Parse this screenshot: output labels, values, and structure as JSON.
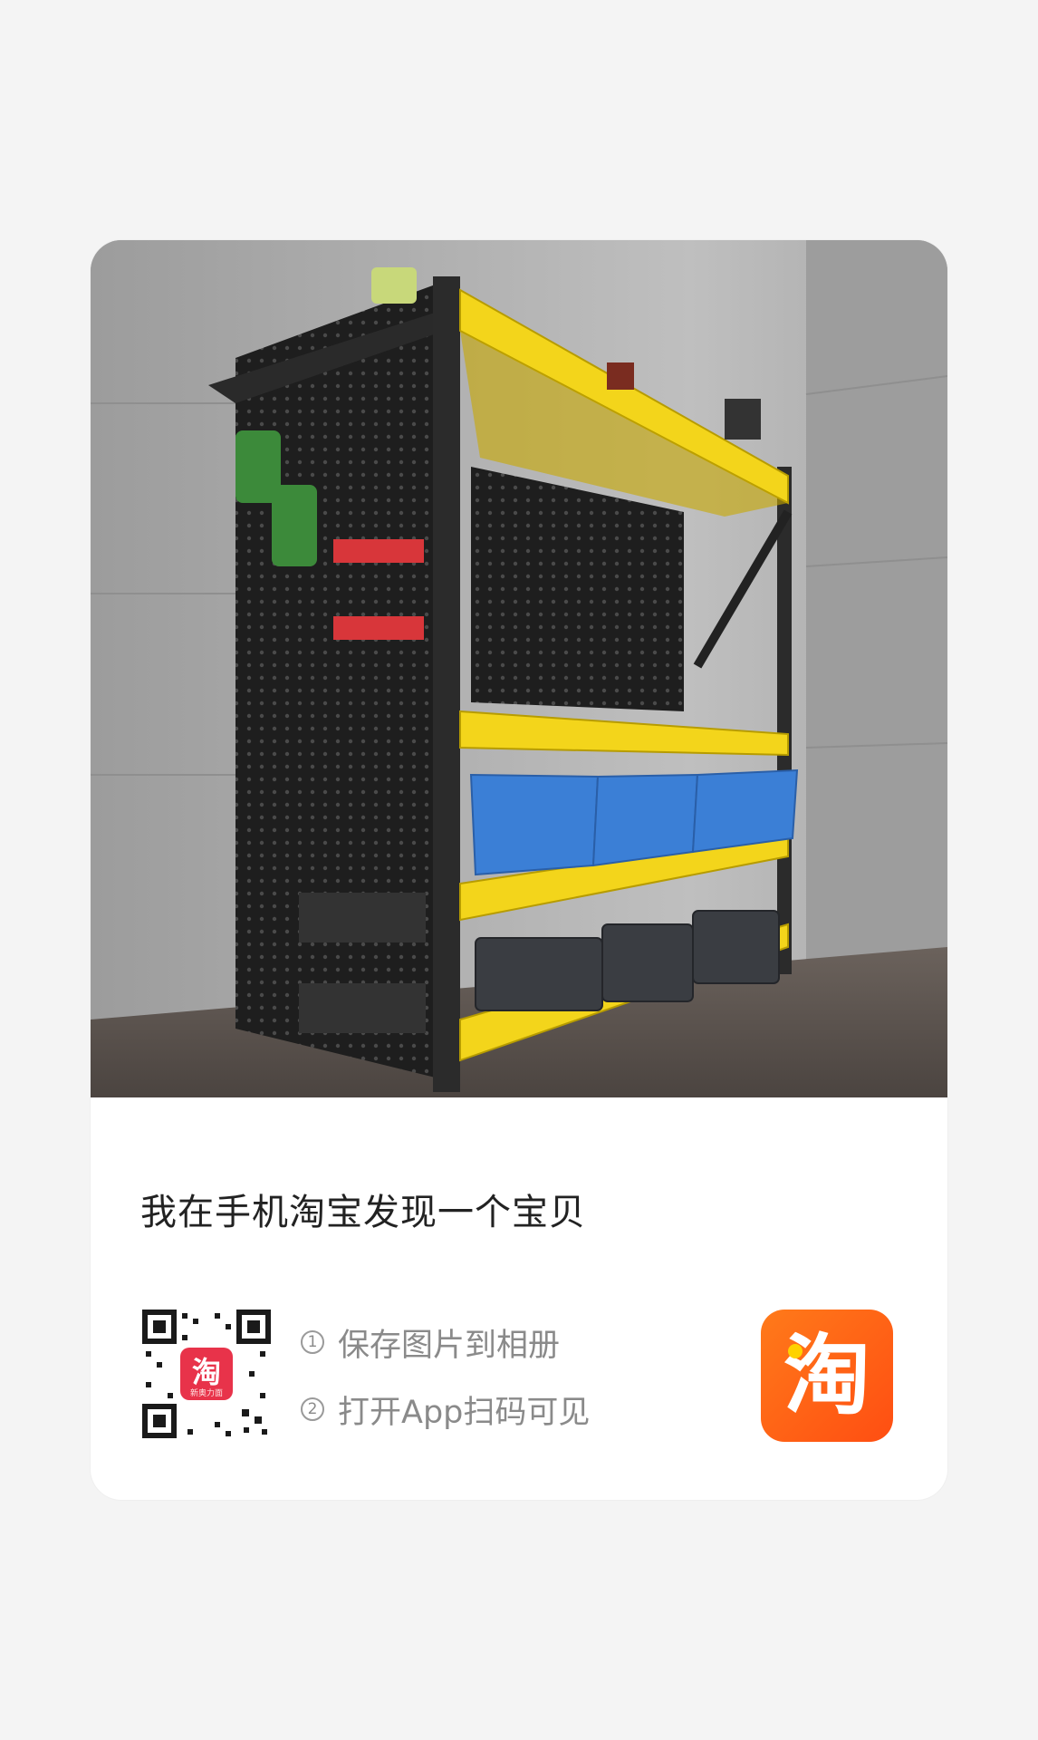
{
  "share_card": {
    "headline": "我在手机淘宝发现一个宝贝",
    "steps": [
      {
        "number": "1",
        "text": "保存图片到相册"
      },
      {
        "number": "2",
        "text": "打开App扫码可见"
      }
    ],
    "qr_center_label": "淘",
    "qr_center_sub": "新奥力面",
    "app_logo_char": "淘",
    "colors": {
      "brand_orange": "#ff5a12",
      "shelf_yellow": "#f3d51b",
      "bin_blue": "#3b7fd6",
      "qr_badge_red": "#e8334a"
    },
    "image_alt": "garage tool shelf with pegboard"
  }
}
